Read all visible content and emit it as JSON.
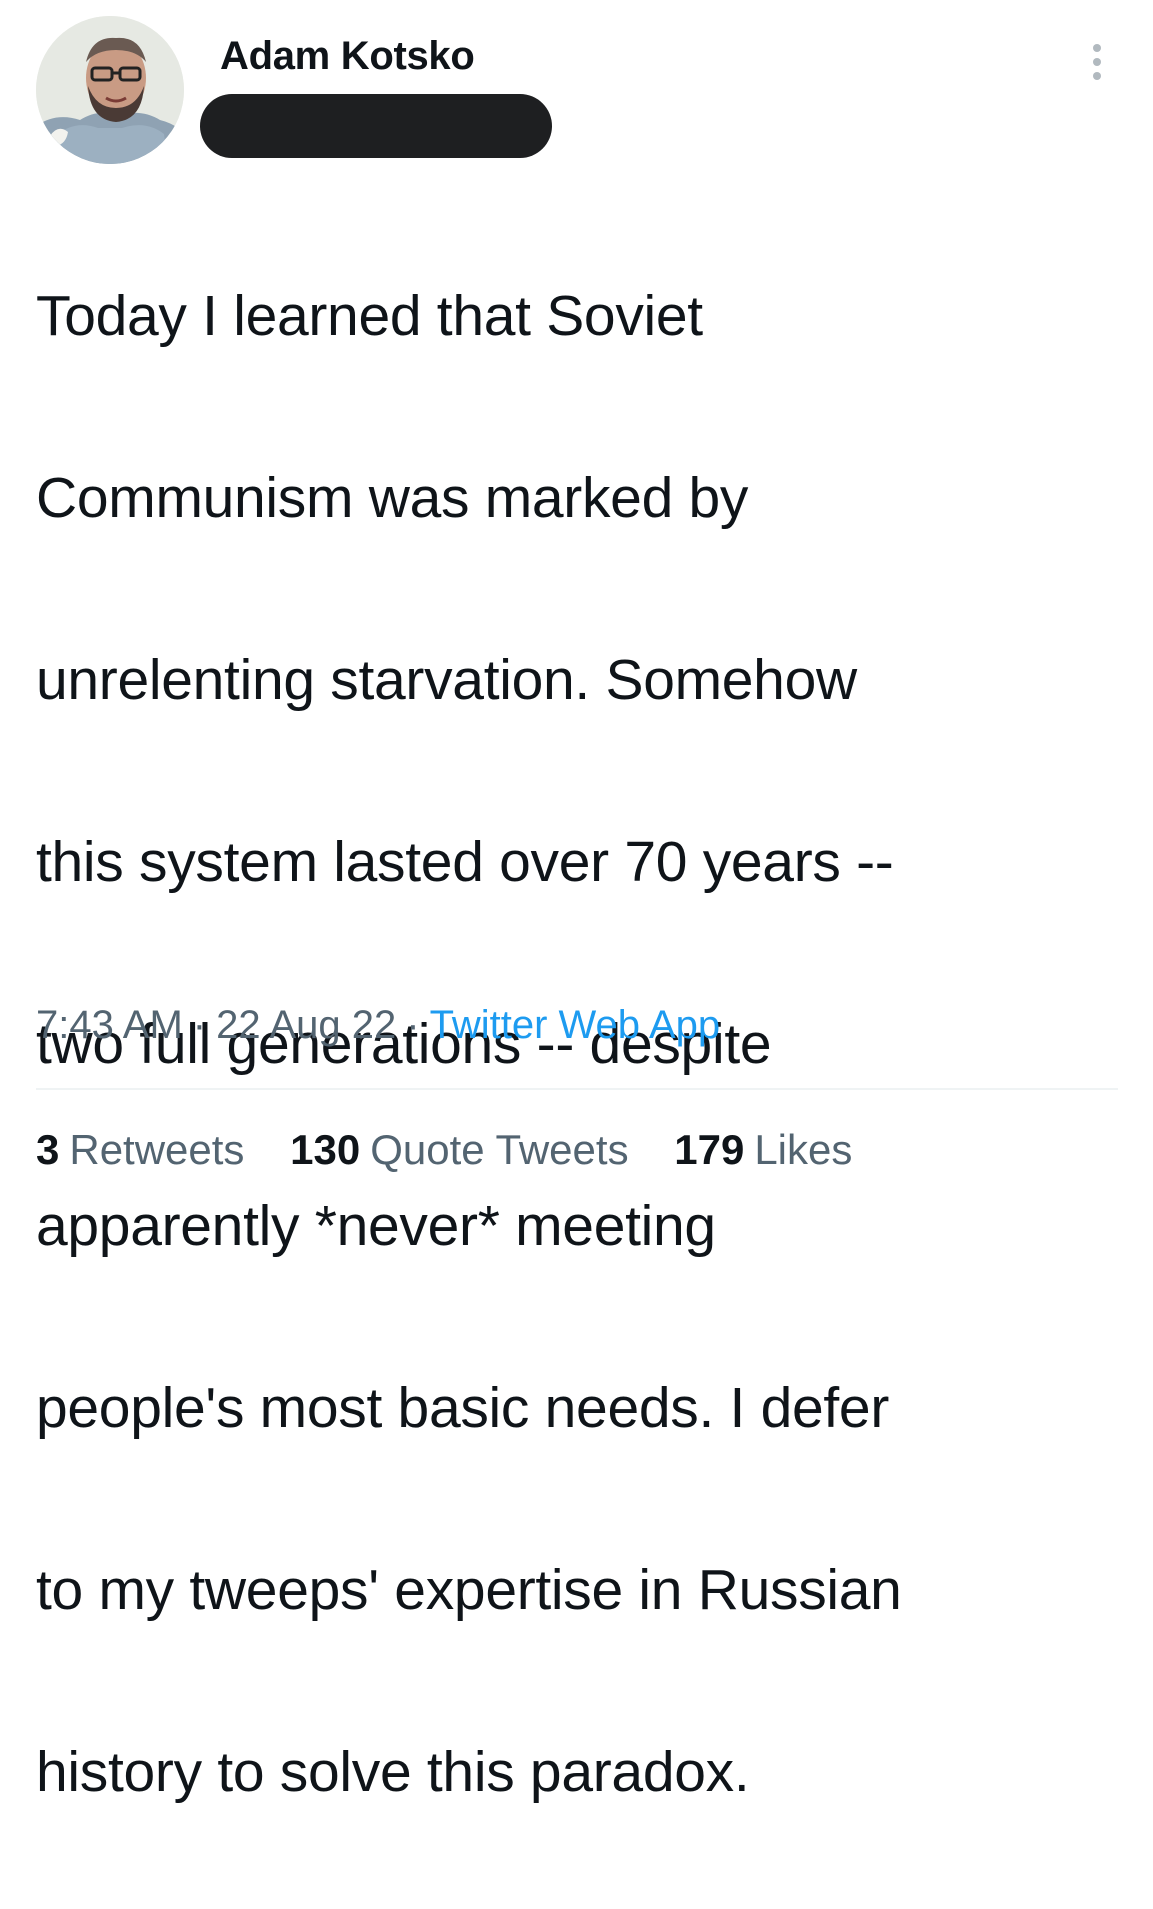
{
  "author": {
    "display_name": "Adam Kotsko",
    "avatar_icon": "avatar-icon",
    "handle_redacted": true
  },
  "tweet": {
    "text_lines": [
      "Today I learned that Soviet",
      "Communism was marked by",
      "unrelenting starvation. Somehow",
      "this system lasted over 70 years --",
      "two full generations -- despite",
      "apparently *never* meeting",
      "people's most basic needs. I defer",
      "to my tweeps' expertise in Russian",
      "history to solve this paradox."
    ],
    "time": "7:43 AM",
    "date": "22 Aug 22",
    "separator": "·",
    "source": "Twitter Web App"
  },
  "stats": {
    "retweets_count": "3",
    "retweets_label": "Retweets",
    "quote_tweets_count": "130",
    "quote_tweets_label": "Quote Tweets",
    "likes_count": "179",
    "likes_label": "Likes"
  },
  "colors": {
    "text_primary": "#0f1419",
    "text_secondary": "#536471",
    "link": "#1d9bf0",
    "divider": "#eff3f4",
    "redaction": "#1e1f21"
  },
  "icons": {
    "more": "more-vertical-icon"
  }
}
